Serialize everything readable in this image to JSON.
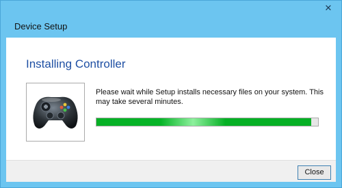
{
  "window": {
    "title": "Device Setup",
    "close_glyph": "✕"
  },
  "content": {
    "heading": "Installing Controller",
    "message": "Please wait while Setup installs necessary files on your system. This may take several minutes.",
    "icon": "gamepad-icon",
    "progress_fraction": 0.97
  },
  "footer": {
    "close_label": "Close"
  },
  "colors": {
    "titlebar": "#6cc5f0",
    "heading": "#1e4fa3",
    "progress_green": "#06b025"
  }
}
